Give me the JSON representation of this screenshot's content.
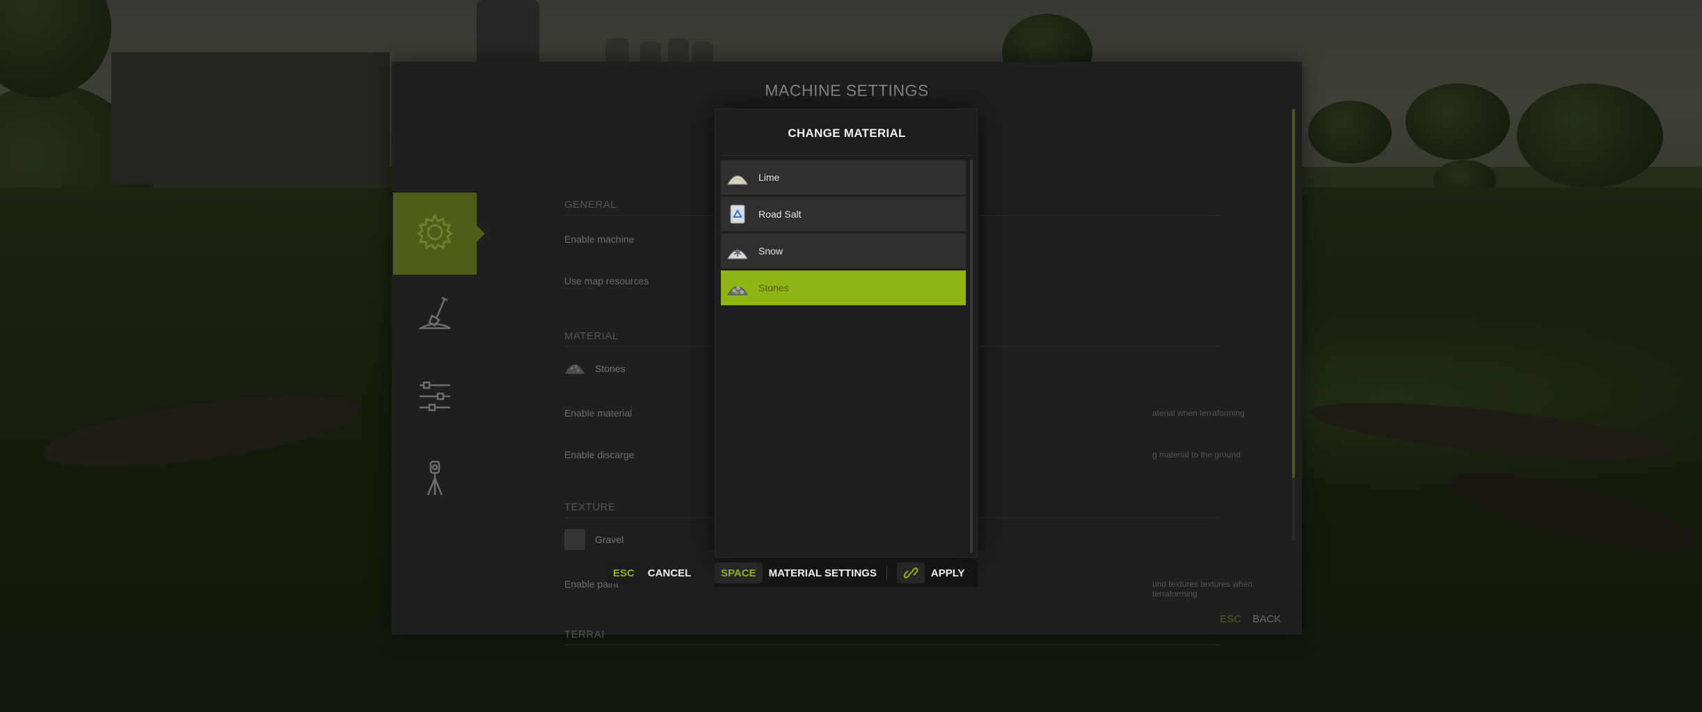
{
  "panel": {
    "title": "MACHINE SETTINGS",
    "sections": {
      "general": "GENERAL",
      "material": "MATERIAL",
      "texture": "TEXTURE",
      "terrain": "TERRAI"
    },
    "rows": {
      "enable_machine": "Enable machine",
      "use_map_resources": "Use map resources",
      "current_material": "Stones",
      "enable_material": "Enable material",
      "enable_material_desc": "aterial when terraforming",
      "enable_discharge": "Enable discarge",
      "enable_discharge_desc": "g material to the ground",
      "current_texture": "Gravel",
      "enable_paint": "Enable paint",
      "enable_paint_desc": "und textures textures when terraforming"
    },
    "nav": [
      {
        "icon": "gear-icon",
        "active": true
      },
      {
        "icon": "shovel-icon",
        "active": false
      },
      {
        "icon": "sliders-icon",
        "active": false
      },
      {
        "icon": "survey-tripod-icon",
        "active": false
      }
    ],
    "footer": {
      "key": "ESC",
      "label": "BACK"
    }
  },
  "dialog": {
    "title": "CHANGE MATERIAL",
    "items": [
      {
        "label": "Lime",
        "icon": "lime-pile-icon",
        "selected": false
      },
      {
        "label": "Road Salt",
        "icon": "road-salt-icon",
        "selected": false
      },
      {
        "label": "Snow",
        "icon": "snow-pile-icon",
        "selected": false
      },
      {
        "label": "Stones",
        "icon": "stones-pile-icon",
        "selected": true
      }
    ],
    "buttons": {
      "cancel_key": "ESC",
      "cancel_label": "CANCEL",
      "settings_key": "SPACE",
      "settings_label": "MATERIAL SETTINGS",
      "apply_icon": "link-icon",
      "apply_label": "APPLY"
    }
  },
  "colors": {
    "accent": "#8fb515",
    "accent_dark": "#4e5e1a",
    "panel_bg": "#1f1f1f",
    "dialog_bg": "#1e1e1e"
  }
}
